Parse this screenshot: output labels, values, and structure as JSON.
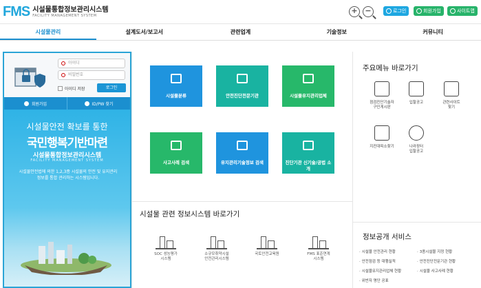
{
  "header": {
    "logo_mark": "FMS",
    "logo_title": "시설물통합정보관리시스템",
    "logo_sub": "FACILITY MANAGEMENT SYSTEM",
    "zoom_in": "+",
    "zoom_out": "−",
    "login": "로그인",
    "signup": "회원가입",
    "sitemap": "사이트맵"
  },
  "nav": [
    "시설물관리",
    "설계도서/보고서",
    "관련업계",
    "기술정보",
    "커뮤니티"
  ],
  "login_box": {
    "id_placeholder": "아이디",
    "pw_placeholder": "비밀번호",
    "save_id": "아이디 저장",
    "login_button": "로그인",
    "tab_signup": "회원가입",
    "tab_find": "ID/PW 찾기"
  },
  "banner": {
    "line1": "시설물안전 확보를 통한",
    "line2": "국민행복기반마련",
    "line3": "시설물통합정보관리시스템",
    "line4": "FACILITY MANAGEMENT SYSTEM",
    "line5": "시설물안전법에 의한 1,2,3종 시설물의 안전 및 유지관리 정보를 통합 관리하는 시스템입니다."
  },
  "tiles": [
    "시설물분류",
    "안전진단전문기관",
    "시설물유지관리업체",
    "사고사례 검색",
    "유지관리기술정보 검색",
    "진단기관 신기술/공법 소개"
  ],
  "systems": {
    "title": "시설물 관련 정보시스템 바로가기",
    "items": [
      [
        "SOC 성능평가",
        "시스템"
      ],
      [
        "소규모취약시설",
        "안전관리시스템"
      ],
      [
        "국토안전교육원"
      ],
      [
        "FMS 표준연계",
        "시스템"
      ]
    ]
  },
  "quick_menu": {
    "title": "주요메뉴 바로가기",
    "items": [
      [
        "점검진단기술자",
        "구인게시판"
      ],
      [
        "입찰공고"
      ],
      [
        "관련사이트",
        "찾기"
      ],
      [
        "지진대피소찾기"
      ],
      [
        "나라장터",
        "입찰공고"
      ]
    ]
  },
  "info_service": {
    "title": "정보공개 서비스",
    "items": [
      "시설물 안전관리 현황",
      "3종시설물 지정 현황",
      "안전점검 등 대행실적",
      "안전진단전문기관 현황",
      "시설물유지관리업체 현황",
      "시설물 사고사례 현황",
      "위반자 명단 공표"
    ]
  },
  "colors": {
    "blue": "#1f94de",
    "teal": "#19b3a1",
    "green": "#27b86a",
    "accent": "#1b8fcf"
  }
}
